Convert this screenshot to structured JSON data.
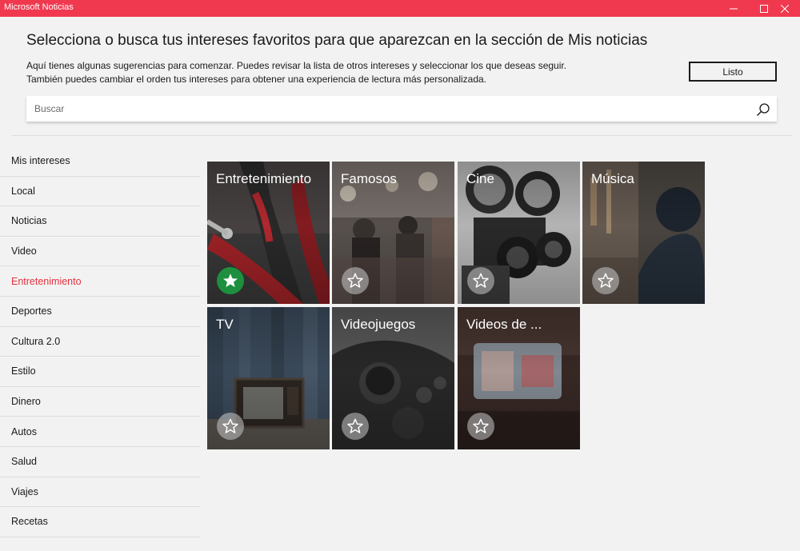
{
  "window": {
    "title": "Microsoft Noticias",
    "accent": "#f0394f"
  },
  "header": {
    "headline": "Selecciona o busca tus intereses favoritos para que aparezcan en la sección de Mis noticias",
    "desc_line1": "Aquí tienes algunas sugerencias para comenzar. Puedes revisar la lista de otros intereses y seleccionar los que deseas seguir.",
    "desc_line2": "También puedes cambiar el orden tus intereses para obtener una experiencia de lectura más personalizada.",
    "done_label": "Listo"
  },
  "search": {
    "placeholder": "Buscar",
    "icon": "search-icon"
  },
  "sidebar": {
    "active_color": "#e4313f",
    "items": [
      {
        "label": "Mis intereses"
      },
      {
        "label": "Local"
      },
      {
        "label": "Noticias"
      },
      {
        "label": "Video"
      },
      {
        "label": "Entretenimiento",
        "active": true
      },
      {
        "label": "Deportes"
      },
      {
        "label": "Cultura 2.0"
      },
      {
        "label": "Estilo"
      },
      {
        "label": "Dinero"
      },
      {
        "label": "Autos"
      },
      {
        "label": "Salud"
      },
      {
        "label": "Viajes"
      },
      {
        "label": "Recetas"
      }
    ]
  },
  "tiles": [
    {
      "label": "Entretenimiento",
      "starred": true,
      "icon": "star-filled-icon"
    },
    {
      "label": "Famosos",
      "starred": false,
      "icon": "star-outline-icon"
    },
    {
      "label": "Cine",
      "starred": false,
      "icon": "star-outline-icon"
    },
    {
      "label": "Música",
      "starred": false,
      "icon": "star-outline-icon"
    },
    {
      "label": "TV",
      "starred": false,
      "icon": "star-outline-icon"
    },
    {
      "label": "Videojuegos",
      "starred": false,
      "icon": "star-outline-icon"
    },
    {
      "label": "Videos de ...",
      "starred": false,
      "icon": "star-outline-icon"
    }
  ],
  "starred_color": "#1e8f3e"
}
